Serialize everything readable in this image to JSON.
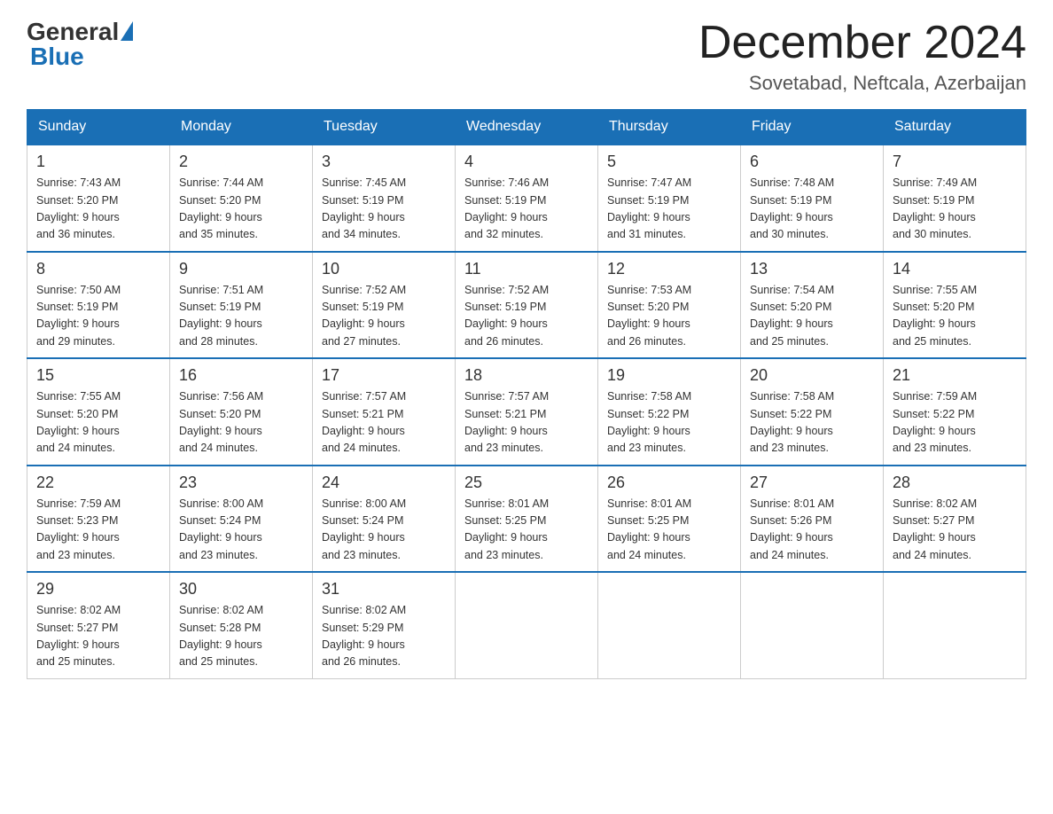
{
  "header": {
    "logo_general": "General",
    "logo_blue": "Blue",
    "month_title": "December 2024",
    "location": "Sovetabad, Neftcala, Azerbaijan"
  },
  "days_of_week": [
    "Sunday",
    "Monday",
    "Tuesday",
    "Wednesday",
    "Thursday",
    "Friday",
    "Saturday"
  ],
  "weeks": [
    [
      {
        "day": "1",
        "sunrise": "7:43 AM",
        "sunset": "5:20 PM",
        "daylight": "9 hours and 36 minutes."
      },
      {
        "day": "2",
        "sunrise": "7:44 AM",
        "sunset": "5:20 PM",
        "daylight": "9 hours and 35 minutes."
      },
      {
        "day": "3",
        "sunrise": "7:45 AM",
        "sunset": "5:19 PM",
        "daylight": "9 hours and 34 minutes."
      },
      {
        "day": "4",
        "sunrise": "7:46 AM",
        "sunset": "5:19 PM",
        "daylight": "9 hours and 32 minutes."
      },
      {
        "day": "5",
        "sunrise": "7:47 AM",
        "sunset": "5:19 PM",
        "daylight": "9 hours and 31 minutes."
      },
      {
        "day": "6",
        "sunrise": "7:48 AM",
        "sunset": "5:19 PM",
        "daylight": "9 hours and 30 minutes."
      },
      {
        "day": "7",
        "sunrise": "7:49 AM",
        "sunset": "5:19 PM",
        "daylight": "9 hours and 30 minutes."
      }
    ],
    [
      {
        "day": "8",
        "sunrise": "7:50 AM",
        "sunset": "5:19 PM",
        "daylight": "9 hours and 29 minutes."
      },
      {
        "day": "9",
        "sunrise": "7:51 AM",
        "sunset": "5:19 PM",
        "daylight": "9 hours and 28 minutes."
      },
      {
        "day": "10",
        "sunrise": "7:52 AM",
        "sunset": "5:19 PM",
        "daylight": "9 hours and 27 minutes."
      },
      {
        "day": "11",
        "sunrise": "7:52 AM",
        "sunset": "5:19 PM",
        "daylight": "9 hours and 26 minutes."
      },
      {
        "day": "12",
        "sunrise": "7:53 AM",
        "sunset": "5:20 PM",
        "daylight": "9 hours and 26 minutes."
      },
      {
        "day": "13",
        "sunrise": "7:54 AM",
        "sunset": "5:20 PM",
        "daylight": "9 hours and 25 minutes."
      },
      {
        "day": "14",
        "sunrise": "7:55 AM",
        "sunset": "5:20 PM",
        "daylight": "9 hours and 25 minutes."
      }
    ],
    [
      {
        "day": "15",
        "sunrise": "7:55 AM",
        "sunset": "5:20 PM",
        "daylight": "9 hours and 24 minutes."
      },
      {
        "day": "16",
        "sunrise": "7:56 AM",
        "sunset": "5:20 PM",
        "daylight": "9 hours and 24 minutes."
      },
      {
        "day": "17",
        "sunrise": "7:57 AM",
        "sunset": "5:21 PM",
        "daylight": "9 hours and 24 minutes."
      },
      {
        "day": "18",
        "sunrise": "7:57 AM",
        "sunset": "5:21 PM",
        "daylight": "9 hours and 23 minutes."
      },
      {
        "day": "19",
        "sunrise": "7:58 AM",
        "sunset": "5:22 PM",
        "daylight": "9 hours and 23 minutes."
      },
      {
        "day": "20",
        "sunrise": "7:58 AM",
        "sunset": "5:22 PM",
        "daylight": "9 hours and 23 minutes."
      },
      {
        "day": "21",
        "sunrise": "7:59 AM",
        "sunset": "5:22 PM",
        "daylight": "9 hours and 23 minutes."
      }
    ],
    [
      {
        "day": "22",
        "sunrise": "7:59 AM",
        "sunset": "5:23 PM",
        "daylight": "9 hours and 23 minutes."
      },
      {
        "day": "23",
        "sunrise": "8:00 AM",
        "sunset": "5:24 PM",
        "daylight": "9 hours and 23 minutes."
      },
      {
        "day": "24",
        "sunrise": "8:00 AM",
        "sunset": "5:24 PM",
        "daylight": "9 hours and 23 minutes."
      },
      {
        "day": "25",
        "sunrise": "8:01 AM",
        "sunset": "5:25 PM",
        "daylight": "9 hours and 23 minutes."
      },
      {
        "day": "26",
        "sunrise": "8:01 AM",
        "sunset": "5:25 PM",
        "daylight": "9 hours and 24 minutes."
      },
      {
        "day": "27",
        "sunrise": "8:01 AM",
        "sunset": "5:26 PM",
        "daylight": "9 hours and 24 minutes."
      },
      {
        "day": "28",
        "sunrise": "8:02 AM",
        "sunset": "5:27 PM",
        "daylight": "9 hours and 24 minutes."
      }
    ],
    [
      {
        "day": "29",
        "sunrise": "8:02 AM",
        "sunset": "5:27 PM",
        "daylight": "9 hours and 25 minutes."
      },
      {
        "day": "30",
        "sunrise": "8:02 AM",
        "sunset": "5:28 PM",
        "daylight": "9 hours and 25 minutes."
      },
      {
        "day": "31",
        "sunrise": "8:02 AM",
        "sunset": "5:29 PM",
        "daylight": "9 hours and 26 minutes."
      },
      null,
      null,
      null,
      null
    ]
  ]
}
